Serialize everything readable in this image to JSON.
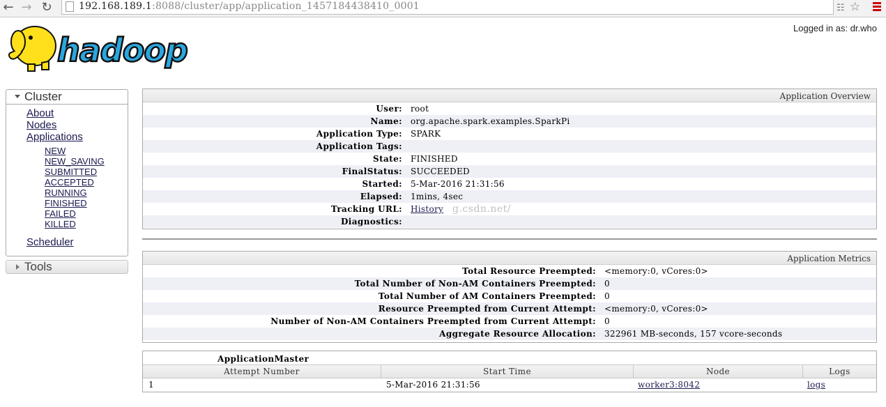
{
  "browser": {
    "back_glyph": "←",
    "forward_glyph": "→",
    "reload_glyph": "↻",
    "url_host": "192.168.189.1",
    "url_rest": ":8088/cluster/app/application_1457184438410_0001",
    "star_glyph": "☆"
  },
  "header": {
    "logo_text": "hadoop",
    "logged_in": "Logged in as: dr.who"
  },
  "sidebar": {
    "cluster_title": "Cluster",
    "links": [
      "About",
      "Nodes",
      "Applications"
    ],
    "app_states": [
      "NEW",
      "NEW_SAVING",
      "SUBMITTED",
      "ACCEPTED",
      "RUNNING",
      "FINISHED",
      "FAILED",
      "KILLED"
    ],
    "scheduler": "Scheduler",
    "tools_title": "Tools"
  },
  "overview": {
    "title": "Application Overview",
    "rows": [
      {
        "key": "User:",
        "value": "root"
      },
      {
        "key": "Name:",
        "value": "org.apache.spark.examples.SparkPi"
      },
      {
        "key": "Application Type:",
        "value": "SPARK"
      },
      {
        "key": "Application Tags:",
        "value": ""
      },
      {
        "key": "State:",
        "value": "FINISHED"
      },
      {
        "key": "FinalStatus:",
        "value": "SUCCEEDED"
      },
      {
        "key": "Started:",
        "value": "5-Mar-2016 21:31:56"
      },
      {
        "key": "Elapsed:",
        "value": "1mins, 4sec"
      },
      {
        "key": "Tracking URL:",
        "value": "History"
      },
      {
        "key": "Diagnostics:",
        "value": ""
      }
    ],
    "watermark": "g.csdn.net/"
  },
  "metrics": {
    "title": "Application Metrics",
    "rows": [
      {
        "key": "Total Resource Preempted:",
        "value": "<memory:0, vCores:0>"
      },
      {
        "key": "Total Number of Non-AM Containers Preempted:",
        "value": "0"
      },
      {
        "key": "Total Number of AM Containers Preempted:",
        "value": "0"
      },
      {
        "key": "Resource Preempted from Current Attempt:",
        "value": "<memory:0, vCores:0>"
      },
      {
        "key": "Number of Non-AM Containers Preempted from Current Attempt:",
        "value": "0"
      },
      {
        "key": "Aggregate Resource Allocation:",
        "value": "322961 MB-seconds, 157 vcore-seconds"
      }
    ]
  },
  "attempts": {
    "caption": "ApplicationMaster",
    "columns": [
      "Attempt Number",
      "Start Time",
      "Node",
      "Logs"
    ],
    "rows": [
      {
        "attempt": "1",
        "start": "5-Mar-2016 21:31:56",
        "node": "worker3:8042",
        "logs": "logs"
      }
    ]
  }
}
